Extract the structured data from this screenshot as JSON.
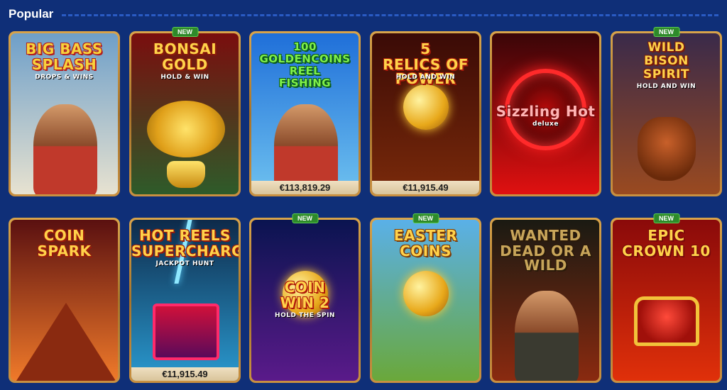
{
  "section": {
    "title": "Popular"
  },
  "games": [
    {
      "id": "big-bass-splash",
      "title_lines": [
        "BIG BASS",
        "SPLASH"
      ],
      "sub": "DROPS & WINS",
      "is_new": false,
      "jackpot": null,
      "colors": {
        "bg1": "#6e9fc9",
        "bg2": "#e7e2d0",
        "title": "#f7d23d",
        "title_stroke": "#b31e1e"
      }
    },
    {
      "id": "bonsai-gold",
      "title_lines": [
        "BONSAI",
        "GOLD"
      ],
      "sub": "HOLD & WIN",
      "is_new": true,
      "jackpot": null,
      "colors": {
        "bg1": "#7a0e0e",
        "bg2": "#2e5b2a",
        "title": "#ffd34a",
        "title_stroke": "#8b1a0a"
      }
    },
    {
      "id": "100-golden-coins-reel-fishing",
      "title_lines": [
        "100",
        "GOLDENCOINS",
        "REEL",
        "FISHING"
      ],
      "sub": "",
      "is_new": false,
      "jackpot": "€113,819.29",
      "colors": {
        "bg1": "#1f6fd9",
        "bg2": "#6ec1ef",
        "title": "#7ff04a",
        "title_stroke": "#0b5a1b"
      }
    },
    {
      "id": "5-relics-of-power",
      "title_lines": [
        "5",
        "RELICS OF POWER"
      ],
      "sub": "HOLD AND WIN",
      "is_new": false,
      "jackpot": "€11,915.49",
      "colors": {
        "bg1": "#3a0a06",
        "bg2": "#7a2a0a",
        "title": "#ffd24a",
        "title_stroke": "#a61a0a"
      }
    },
    {
      "id": "sizzling-hot-deluxe",
      "title_lines": [
        "Sizzling Hot"
      ],
      "sub": "deluxe",
      "is_new": false,
      "jackpot": null,
      "colors": {
        "bg1": "#3a0508",
        "bg2": "#e01010",
        "title": "#ffb4b4",
        "title_stroke": "#7a0a0a"
      }
    },
    {
      "id": "wild-bison-spirit",
      "title_lines": [
        "WILD",
        "BISON",
        "SPIRIT"
      ],
      "sub": "HOLD AND WIN",
      "is_new": true,
      "jackpot": null,
      "colors": {
        "bg1": "#3a2a4a",
        "bg2": "#9a4a20",
        "title": "#ffd24a",
        "title_stroke": "#7a1a0a"
      }
    },
    {
      "id": "coin-spark",
      "title_lines": [
        "COIN",
        "SPARK"
      ],
      "sub": "",
      "is_new": false,
      "jackpot": null,
      "colors": {
        "bg1": "#5a1010",
        "bg2": "#f07a2a",
        "title": "#ffd24a",
        "title_stroke": "#9a1a0a"
      }
    },
    {
      "id": "hot-reels-supercharged",
      "title_lines": [
        "HOT REELS",
        "SUPERCHARGED"
      ],
      "sub": "JACKPOT HUNT",
      "is_new": false,
      "jackpot": "€11,915.49",
      "colors": {
        "bg1": "#0e2a4a",
        "bg2": "#2a9ad0",
        "title": "#ffd24a",
        "title_stroke": "#9a1a0a"
      }
    },
    {
      "id": "coin-win-2",
      "title_lines": [
        "COIN",
        "WIN 2"
      ],
      "sub": "HOLD THE SPIN",
      "is_new": true,
      "jackpot": null,
      "colors": {
        "bg1": "#0a1450",
        "bg2": "#5a1a8a",
        "title": "#ffd24a",
        "title_stroke": "#b01a0a"
      }
    },
    {
      "id": "easter-coins",
      "title_lines": [
        "EASTER",
        "COINS"
      ],
      "sub": "",
      "is_new": true,
      "jackpot": null,
      "colors": {
        "bg1": "#5ab0e8",
        "bg2": "#6aa83a",
        "title": "#ffd24a",
        "title_stroke": "#7a3a0a"
      }
    },
    {
      "id": "wanted-dead-or-a-wild",
      "title_lines": [
        "WANTED",
        "DEAD OR A WILD"
      ],
      "sub": "",
      "is_new": false,
      "jackpot": null,
      "colors": {
        "bg1": "#1a1a12",
        "bg2": "#8a2a10",
        "title": "#c8a55a",
        "title_stroke": "#2a1a0a"
      }
    },
    {
      "id": "epic-crown-10",
      "title_lines": [
        "EPIC",
        "CROWN 10"
      ],
      "sub": "",
      "is_new": true,
      "jackpot": null,
      "colors": {
        "bg1": "#8a0a0a",
        "bg2": "#e0300a",
        "title": "#ffd24a",
        "title_stroke": "#7a0a0a"
      }
    }
  ],
  "new_badge_label": "NEW"
}
